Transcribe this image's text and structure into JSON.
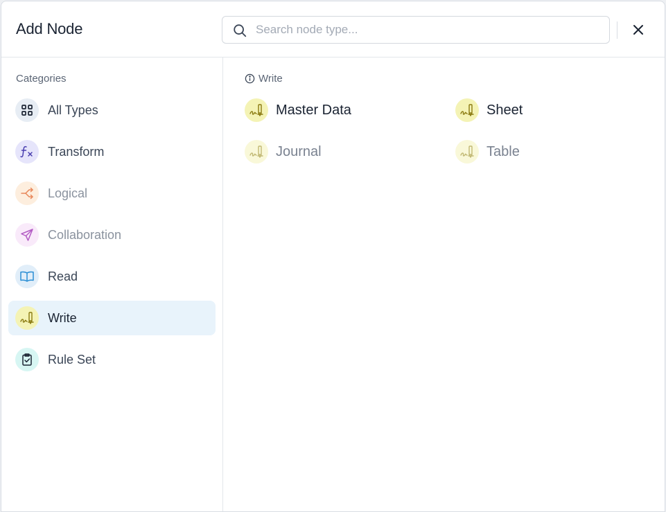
{
  "dialog": {
    "title": "Add Node",
    "search_placeholder": "Search node type..."
  },
  "sidebar": {
    "section_label": "Categories",
    "items": [
      {
        "label": "All Types",
        "icon": "grid-icon",
        "state": "normal"
      },
      {
        "label": "Transform",
        "icon": "function-icon",
        "state": "normal"
      },
      {
        "label": "Logical",
        "icon": "branch-icon",
        "state": "dim"
      },
      {
        "label": "Collaboration",
        "icon": "send-icon",
        "state": "dim"
      },
      {
        "label": "Read",
        "icon": "book-icon",
        "state": "normal"
      },
      {
        "label": "Write",
        "icon": "pen-write-icon",
        "state": "active"
      },
      {
        "label": "Rule Set",
        "icon": "clipboard-check-icon",
        "state": "normal"
      }
    ]
  },
  "main": {
    "section_label": "Write",
    "nodes": [
      {
        "label": "Master Data",
        "icon": "pen-write-icon",
        "state": "normal"
      },
      {
        "label": "Sheet",
        "icon": "pen-write-icon",
        "state": "normal"
      },
      {
        "label": "Journal",
        "icon": "pen-write-icon",
        "state": "dim"
      },
      {
        "label": "Table",
        "icon": "pen-write-icon",
        "state": "dim"
      }
    ]
  },
  "colors": {
    "active_bg": "#e8f3fb",
    "write_circle": "#f4f3b5",
    "write_icon": "#8a7a10"
  }
}
